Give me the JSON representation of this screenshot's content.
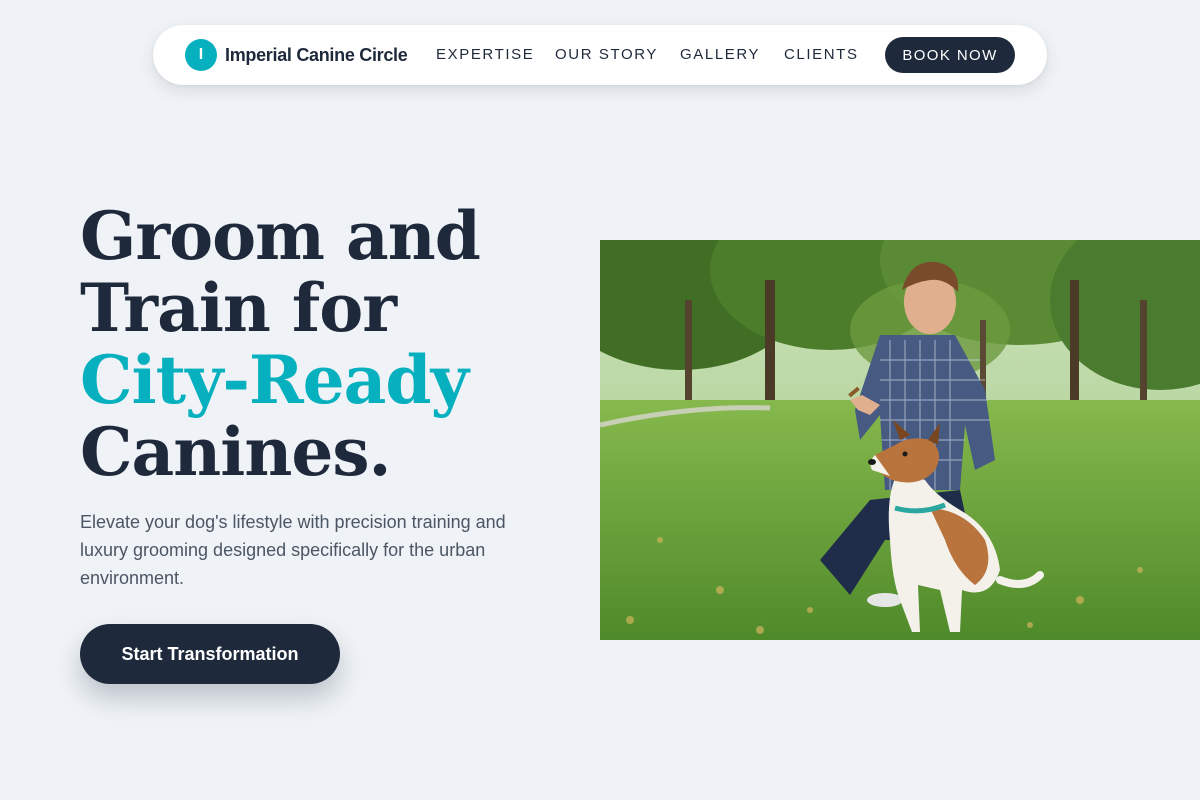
{
  "brand": {
    "mark": "I",
    "name": "Imperial Canine Circle"
  },
  "nav": {
    "links": [
      "EXPERTISE",
      "OUR STORY",
      "GALLERY",
      "CLIENTS"
    ],
    "book_label": "BOOK NOW"
  },
  "hero": {
    "headline": [
      "Groom and",
      "Train for",
      "City-Ready",
      "Canines."
    ],
    "subtext": "Elevate your dog's lifestyle with precision training and luxury grooming designed specifically for the urban environment.",
    "cta_label": "Start Transformation"
  },
  "image": {
    "subject": "man-training-dog-in-park"
  },
  "colors": {
    "accent": "#06b0be",
    "dark": "#1e293b",
    "background": "#eff3f7"
  }
}
